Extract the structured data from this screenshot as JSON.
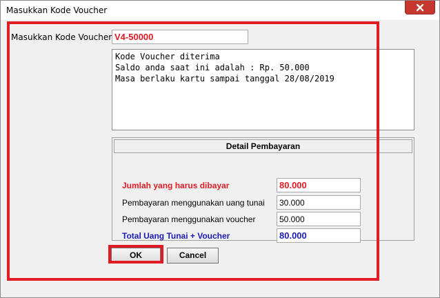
{
  "window": {
    "title": "Masukkan Kode Voucher",
    "close_icon": "close-icon",
    "close_color": "#c7372f"
  },
  "form": {
    "voucher_label": "Masukkan Kode Voucher",
    "voucher_value": "V4-50000",
    "message_lines": [
      "Kode Voucher diterima",
      "Saldo anda saat ini adalah : Rp. 50.000",
      "Masa berlaku kartu sampai tanggal 28/08/2019"
    ]
  },
  "detail": {
    "header": "Detail Pembayaran",
    "rows": [
      {
        "label": "Jumlah yang harus dibayar",
        "value": "80.000"
      },
      {
        "label": "Pembayaran menggunakan uang tunai",
        "value": "30.000"
      },
      {
        "label": "Pembayaran menggunakan voucher",
        "value": "50.000"
      },
      {
        "label": "Total Uang Tunai + Voucher",
        "value": "80.000"
      }
    ]
  },
  "buttons": {
    "ok_label": "OK",
    "cancel_label": "Cancel"
  },
  "colors": {
    "highlight": "#e01b24",
    "total_text": "#1a1ab8"
  }
}
